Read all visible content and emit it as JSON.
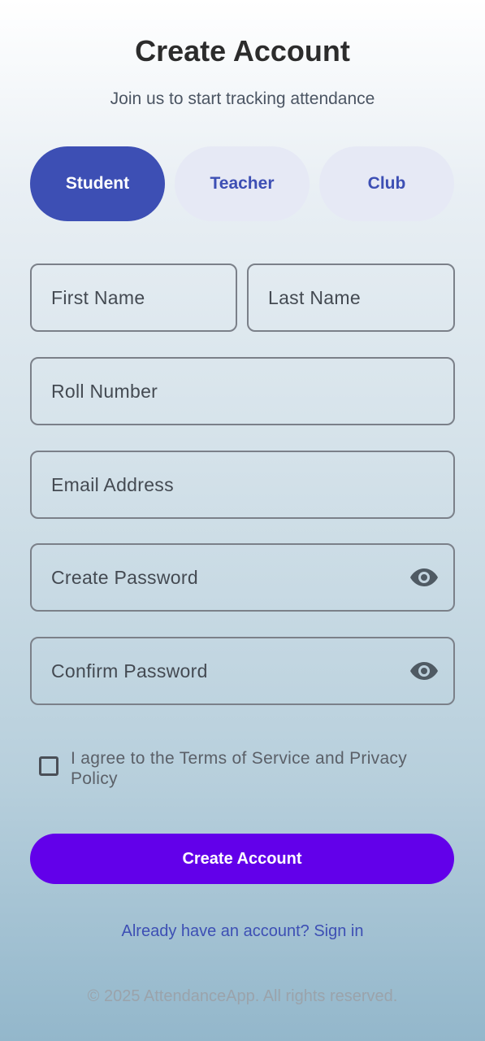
{
  "header": {
    "title": "Create Account",
    "subtitle": "Join us to start tracking attendance"
  },
  "roles": {
    "selected": "Student",
    "items": [
      {
        "label": "Student"
      },
      {
        "label": "Teacher"
      },
      {
        "label": "Club"
      }
    ]
  },
  "form": {
    "first_name": {
      "placeholder": "First Name",
      "value": ""
    },
    "last_name": {
      "placeholder": "Last Name",
      "value": ""
    },
    "roll_number": {
      "placeholder": "Roll Number",
      "value": ""
    },
    "email": {
      "placeholder": "Email Address",
      "value": ""
    },
    "password": {
      "placeholder": "Create Password",
      "value": "",
      "icon": "eye-icon"
    },
    "confirm_password": {
      "placeholder": "Confirm Password",
      "value": "",
      "icon": "eye-icon"
    }
  },
  "terms": {
    "checked": false,
    "text": "I agree to the Terms of Service and Privacy Policy"
  },
  "actions": {
    "submit_label": "Create Account",
    "signin_link": "Already have an account? Sign in"
  },
  "footer": {
    "copyright": "© 2025 AttendanceApp. All rights reserved."
  },
  "colors": {
    "accent": "#3d4fb4",
    "accent_soft": "#e6e9f5",
    "primary_button": "#6200ea"
  }
}
